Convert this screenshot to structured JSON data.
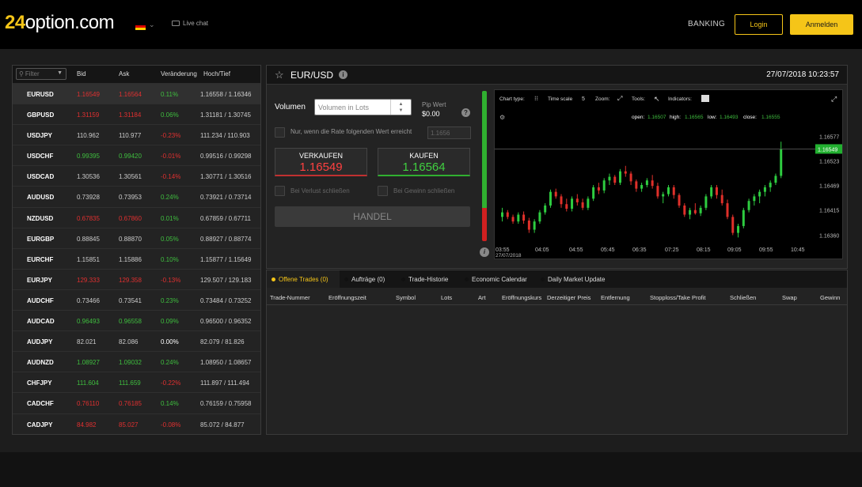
{
  "header": {
    "logo_num": "24",
    "logo_text": "option.com",
    "flag_colors": [
      "#000000",
      "#dd0000",
      "#ffce00"
    ],
    "live_chat": "Live chat",
    "banking": "BANKING",
    "login": "Login",
    "anmelden": "Anmelden",
    "accent": "#f5c518"
  },
  "rates": {
    "filter_placeholder": "Filter",
    "columns": [
      "Bid",
      "Ask",
      "Veränderung",
      "Hoch/Tief"
    ],
    "rows": [
      {
        "sym": "EURUSD",
        "bid": "1.16549",
        "ask": "1.16564",
        "chg": "0.11%",
        "hl": "1.16558 / 1.16346",
        "bc": "red",
        "cc": "green"
      },
      {
        "sym": "GBPUSD",
        "bid": "1.31159",
        "ask": "1.31184",
        "chg": "0.06%",
        "hl": "1.31181 / 1.30745",
        "bc": "red",
        "cc": "green"
      },
      {
        "sym": "USDJPY",
        "bid": "110.962",
        "ask": "110.977",
        "chg": "-0.23%",
        "hl": "111.234 / 110.903",
        "bc": "grey",
        "cc": "red"
      },
      {
        "sym": "USDCHF",
        "bid": "0.99395",
        "ask": "0.99420",
        "chg": "-0.01%",
        "hl": "0.99516 / 0.99298",
        "bc": "green",
        "cc": "red"
      },
      {
        "sym": "USDCAD",
        "bid": "1.30536",
        "ask": "1.30561",
        "chg": "-0.14%",
        "hl": "1.30771 / 1.30516",
        "bc": "grey",
        "cc": "red"
      },
      {
        "sym": "AUDUSD",
        "bid": "0.73928",
        "ask": "0.73953",
        "chg": "0.24%",
        "hl": "0.73921 / 0.73714",
        "bc": "grey",
        "cc": "green"
      },
      {
        "sym": "NZDUSD",
        "bid": "0.67835",
        "ask": "0.67860",
        "chg": "0.01%",
        "hl": "0.67859 / 0.67711",
        "bc": "red",
        "cc": "green"
      },
      {
        "sym": "EURGBP",
        "bid": "0.88845",
        "ask": "0.88870",
        "chg": "0.05%",
        "hl": "0.88927 / 0.88774",
        "bc": "grey",
        "cc": "green"
      },
      {
        "sym": "EURCHF",
        "bid": "1.15851",
        "ask": "1.15886",
        "chg": "0.10%",
        "hl": "1.15877 / 1.15649",
        "bc": "grey",
        "cc": "green"
      },
      {
        "sym": "EURJPY",
        "bid": "129.333",
        "ask": "129.358",
        "chg": "-0.13%",
        "hl": "129.507 / 129.183",
        "bc": "red",
        "cc": "red"
      },
      {
        "sym": "AUDCHF",
        "bid": "0.73466",
        "ask": "0.73541",
        "chg": "0.23%",
        "hl": "0.73484 / 0.73252",
        "bc": "grey",
        "cc": "green"
      },
      {
        "sym": "AUDCAD",
        "bid": "0.96493",
        "ask": "0.96558",
        "chg": "0.09%",
        "hl": "0.96500 / 0.96352",
        "bc": "green",
        "cc": "green"
      },
      {
        "sym": "AUDJPY",
        "bid": "82.021",
        "ask": "82.086",
        "chg": "0.00%",
        "hl": "82.079 / 81.826",
        "bc": "grey",
        "cc": "white"
      },
      {
        "sym": "AUDNZD",
        "bid": "1.08927",
        "ask": "1.09032",
        "chg": "0.24%",
        "hl": "1.08950 / 1.08657",
        "bc": "green",
        "cc": "green"
      },
      {
        "sym": "CHFJPY",
        "bid": "111.604",
        "ask": "111.659",
        "chg": "-0.22%",
        "hl": "111.897 / 111.494",
        "bc": "green",
        "cc": "red"
      },
      {
        "sym": "CADCHF",
        "bid": "0.76110",
        "ask": "0.76185",
        "chg": "0.14%",
        "hl": "0.76159 / 0.75958",
        "bc": "red",
        "cc": "green"
      },
      {
        "sym": "CADJPY",
        "bid": "84.982",
        "ask": "85.027",
        "chg": "-0.08%",
        "hl": "85.072 / 84.877",
        "bc": "red",
        "cc": "red"
      }
    ]
  },
  "trade": {
    "pair": "EUR/USD",
    "datetime": "27/07/2018 10:23:57",
    "volume_label": "Volumen",
    "volume_placeholder": "Volumen in Lots",
    "pip_label": "Pip Wert",
    "pip_value": "$0.00",
    "rate_condition": "Nur, wenn die Rate folgenden Wert erreicht",
    "rate_value": "1.1656",
    "sell_label": "VERKAUFEN",
    "sell_price": "1.16549",
    "buy_label": "KAUFEN",
    "buy_price": "1.16564",
    "stop_loss": "Bei Verlust schließen",
    "take_profit": "Bei Gewinn schließen",
    "handel": "HANDEL",
    "sentiment_buy_pct": 78
  },
  "chart": {
    "toolbar": {
      "chart_type": "Chart type:",
      "time_scale": "Time scale",
      "zoom": "Zoom:",
      "tools": "Tools:",
      "indicators": "Indicators:"
    },
    "ohlc": {
      "open_label": "open:",
      "open": "1.16507",
      "high_label": "high:",
      "high": "1.16565",
      "low_label": "low:",
      "low": "1.16493",
      "close_label": "close:",
      "close": "1.16555"
    },
    "current": "1.16549",
    "y_ticks": [
      "1.16577",
      "1.16523",
      "1.16469",
      "1.16415",
      "1.16360"
    ],
    "x_ticks": [
      "03:55",
      "04:05",
      "04:55",
      "05:45",
      "06:35",
      "07:25",
      "08:15",
      "09:05",
      "09:55",
      "10:45"
    ],
    "x_date": "27/07/2018"
  },
  "chart_data": {
    "type": "candlestick",
    "ylim": [
      1.1634,
      1.166
    ],
    "current": 1.16549,
    "candles": [
      [
        1.164,
        1.1642,
        1.1639,
        1.1641
      ],
      [
        1.1641,
        1.16415,
        1.16395,
        1.164
      ],
      [
        1.164,
        1.16405,
        1.16385,
        1.1639
      ],
      [
        1.1639,
        1.1641,
        1.16385,
        1.16405
      ],
      [
        1.16405,
        1.16412,
        1.16385,
        1.16392
      ],
      [
        1.16392,
        1.16398,
        1.16365,
        1.16372
      ],
      [
        1.16372,
        1.16395,
        1.16365,
        1.1639
      ],
      [
        1.1639,
        1.16415,
        1.16385,
        1.1641
      ],
      [
        1.1641,
        1.1643,
        1.16405,
        1.16425
      ],
      [
        1.16425,
        1.1646,
        1.1642,
        1.16455
      ],
      [
        1.16455,
        1.16462,
        1.1644,
        1.16445
      ],
      [
        1.16445,
        1.1645,
        1.1642,
        1.16428
      ],
      [
        1.16428,
        1.1644,
        1.16412,
        1.16418
      ],
      [
        1.16418,
        1.16445,
        1.16412,
        1.1644
      ],
      [
        1.1644,
        1.1645,
        1.16425,
        1.16432
      ],
      [
        1.16432,
        1.1644,
        1.16415,
        1.1642
      ],
      [
        1.1642,
        1.16445,
        1.16415,
        1.1644
      ],
      [
        1.1644,
        1.1647,
        1.16435,
        1.16465
      ],
      [
        1.16465,
        1.16475,
        1.1645,
        1.16458
      ],
      [
        1.16458,
        1.16485,
        1.16452,
        1.1648
      ],
      [
        1.1648,
        1.16495,
        1.1647,
        1.16488
      ],
      [
        1.16488,
        1.16492,
        1.1647,
        1.16475
      ],
      [
        1.16475,
        1.16505,
        1.1647,
        1.165
      ],
      [
        1.165,
        1.16512,
        1.16488,
        1.16495
      ],
      [
        1.16495,
        1.165,
        1.1647,
        1.16478
      ],
      [
        1.16478,
        1.16482,
        1.16455,
        1.16462
      ],
      [
        1.16462,
        1.16475,
        1.16455,
        1.1647
      ],
      [
        1.1647,
        1.16485,
        1.16465,
        1.1648
      ],
      [
        1.1648,
        1.16492,
        1.16462,
        1.16468
      ],
      [
        1.16468,
        1.16475,
        1.1644,
        1.16445
      ],
      [
        1.16445,
        1.16455,
        1.1643,
        1.1645
      ],
      [
        1.1645,
        1.1647,
        1.16445,
        1.16465
      ],
      [
        1.16465,
        1.1647,
        1.1644,
        1.16448
      ],
      [
        1.16448,
        1.16452,
        1.1642,
        1.16425
      ],
      [
        1.16425,
        1.1643,
        1.164,
        1.16405
      ],
      [
        1.16405,
        1.1642,
        1.16395,
        1.16415
      ],
      [
        1.16415,
        1.1643,
        1.16405,
        1.16408
      ],
      [
        1.16408,
        1.16425,
        1.16402,
        1.1642
      ],
      [
        1.1642,
        1.1645,
        1.16415,
        1.16445
      ],
      [
        1.16445,
        1.1647,
        1.1644,
        1.16465
      ],
      [
        1.16465,
        1.1647,
        1.1644,
        1.16448
      ],
      [
        1.16448,
        1.1646,
        1.16425,
        1.1643
      ],
      [
        1.1643,
        1.16438,
        1.16395,
        1.164
      ],
      [
        1.164,
        1.16405,
        1.1636,
        1.16365
      ],
      [
        1.16365,
        1.16385,
        1.16355,
        1.1638
      ],
      [
        1.1638,
        1.1642,
        1.16375,
        1.16415
      ],
      [
        1.16415,
        1.1644,
        1.1641,
        1.16435
      ],
      [
        1.16435,
        1.1645,
        1.16425,
        1.16445
      ],
      [
        1.16445,
        1.1646,
        1.1643,
        1.16455
      ],
      [
        1.16455,
        1.1647,
        1.16445,
        1.16465
      ],
      [
        1.16465,
        1.1648,
        1.16455,
        1.16475
      ],
      [
        1.16475,
        1.16495,
        1.1647,
        1.1649
      ],
      [
        1.1649,
        1.16565,
        1.16485,
        1.16549
      ]
    ]
  },
  "bottom": {
    "tabs": [
      "Offene Trades (0)",
      "Aufträge (0)",
      "Trade-Historie",
      "Economic Calendar",
      "Daily Market Update"
    ],
    "columns": [
      "Trade-Nummer",
      "Eröffnungszeit",
      "Symbol",
      "Lots",
      "Art",
      "Eröffnungskurs",
      "Derzeitiger Preis",
      "Entfernung",
      "Stopploss/Take Profit",
      "Schließen",
      "Swap",
      "Gewinn"
    ]
  }
}
